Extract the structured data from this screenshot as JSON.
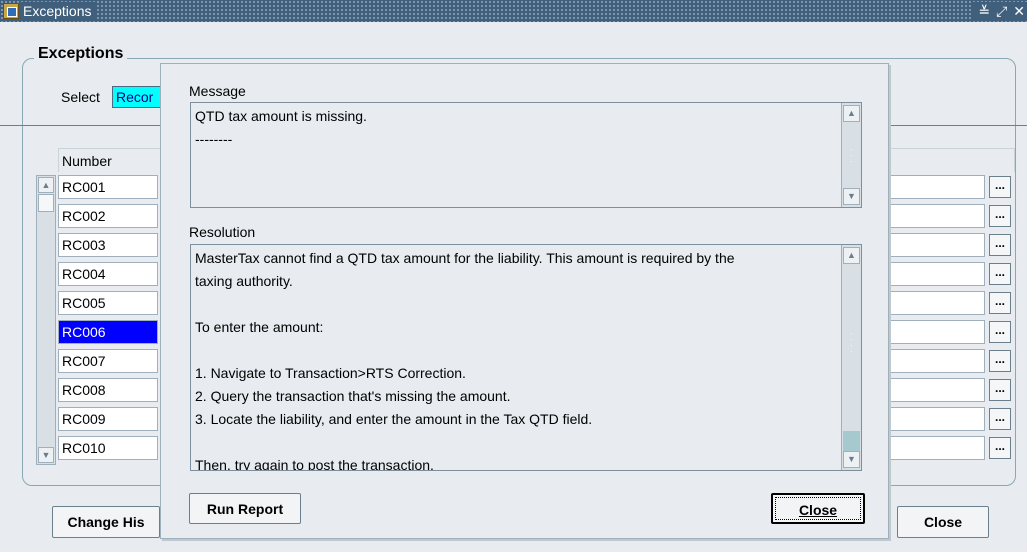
{
  "window": {
    "title": "Exceptions",
    "controls": [
      "≚",
      "⤢",
      "✕"
    ]
  },
  "exceptions": {
    "group_title": "Exceptions",
    "select_label": "Select",
    "select_value": "Recor",
    "column_header": "Number",
    "rows": [
      "RC001",
      "RC002",
      "RC003",
      "RC004",
      "RC005",
      "RC006",
      "RC007",
      "RC008",
      "RC009",
      "RC010"
    ],
    "selected_row": "RC006",
    "lov_label": "...",
    "buttons": {
      "change_history": "Change His",
      "close": "Close"
    }
  },
  "dialog": {
    "message_label": "Message",
    "message_lines": [
      "QTD tax amount is missing.",
      "--------"
    ],
    "resolution_label": "Resolution",
    "resolution_lines": [
      "MasterTax cannot find a QTD tax amount for the liability. This amount is required by the",
      "taxing authority.",
      "",
      "To enter the amount:",
      "",
      "1. Navigate to Transaction>RTS Correction.",
      "2. Query the transaction that's missing the amount.",
      "3. Locate the liability, and enter the amount in the Tax QTD field.",
      "",
      "Then, try again to post the transaction."
    ],
    "buttons": {
      "run_report": "Run Report",
      "close": "Close"
    }
  }
}
